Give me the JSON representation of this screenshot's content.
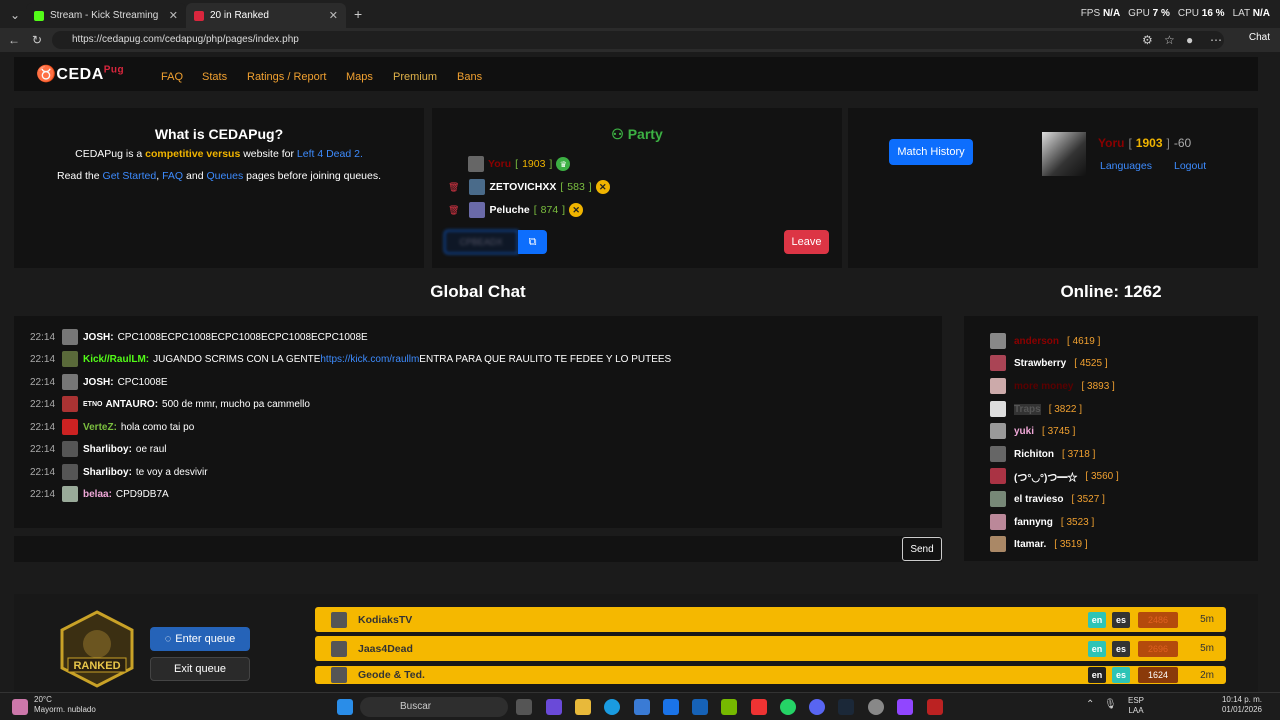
{
  "browser": {
    "tabs": [
      {
        "label": "Stream - Kick Streaming",
        "fav_color": "#53fc18"
      },
      {
        "label": "20 in Ranked",
        "fav_color": "#d9263d"
      }
    ],
    "url": "https://cedapug.com/cedapug/php/pages/index.php",
    "perf": {
      "fps_label": "FPS",
      "fps": "N/A",
      "gpu_label": "GPU",
      "gpu": "7 %",
      "cpu_label": "CPU",
      "cpu": "16 %",
      "lat_label": "LAT",
      "lat": "N/A"
    },
    "chat_label": "Chat"
  },
  "site": {
    "logo_text": "CEDA",
    "logo_sup": "Pug",
    "nav": [
      "FAQ",
      "Stats",
      "Ratings / Report",
      "Maps",
      "Premium",
      "Bans"
    ]
  },
  "about": {
    "title": "What is CEDAPug?",
    "line1_a": "CEDAPug is a ",
    "line1_b": "competitive versus",
    "line1_c": " website for ",
    "line1_d": "Left 4 Dead 2.",
    "line2_a": "Read the ",
    "line2_b": "Get Started",
    "line2_c": ", ",
    "line2_d": "FAQ",
    "line2_e": " and ",
    "line2_f": "Queues",
    "line2_g": " pages before joining queues."
  },
  "party": {
    "title": "Party",
    "members": [
      {
        "name": "Yoru",
        "elo": "1903",
        "badge": "crown",
        "name_color": "#8b0000"
      },
      {
        "name": "ZETOVICHXX",
        "elo": "583",
        "badge": "x",
        "name_color": "#ffffff"
      },
      {
        "name": "Peluche",
        "elo": "874",
        "badge": "x",
        "name_color": "#ffffff"
      }
    ],
    "code_placeholder": "CPBEADX",
    "leave_label": "Leave"
  },
  "profile": {
    "match_history_label": "Match History",
    "name": "Yoru",
    "elo": "1903",
    "delta": "-60",
    "languages_label": "Languages",
    "logout_label": "Logout"
  },
  "chat": {
    "title": "Global Chat",
    "messages": [
      {
        "time": "22:14",
        "nick": "JOSH:",
        "nick_color": "#ffffff",
        "text": "CPC1008ECPC1008ECPC1008ECPC1008ECPC1008E",
        "link": "",
        "text2": "",
        "tag": ""
      },
      {
        "time": "22:14",
        "nick": "Kick//RaulLM:",
        "nick_color": "#53fc18",
        "text": "JUGANDO SCRIMS CON LA GENTE ",
        "link": "https://kick.com/raullm",
        "text2": " ENTRA PARA QUE RAULITO TE FEDEE Y LO PUTEES",
        "tag": ""
      },
      {
        "time": "22:14",
        "nick": "JOSH:",
        "nick_color": "#ffffff",
        "text": "CPC1008E",
        "link": "",
        "text2": "",
        "tag": ""
      },
      {
        "time": "22:14",
        "nick": "ANTAURO:",
        "nick_color": "#ffffff",
        "text": "500 de mmr, mucho pa cammello",
        "link": "",
        "text2": "",
        "tag": "ETNO"
      },
      {
        "time": "22:14",
        "nick": "VerteZ:",
        "nick_color": "#7bbf3f",
        "text": "hola como tai po",
        "link": "",
        "text2": "",
        "tag": ""
      },
      {
        "time": "22:14",
        "nick": "Sharliboy:",
        "nick_color": "#ffffff",
        "text": "oe raul",
        "link": "",
        "text2": "",
        "tag": ""
      },
      {
        "time": "22:14",
        "nick": "Sharliboy:",
        "nick_color": "#ffffff",
        "text": "te voy a desvivir",
        "link": "",
        "text2": "",
        "tag": ""
      },
      {
        "time": "22:14",
        "nick": "belaa:",
        "nick_color": "#f0a8d8",
        "text": "CPD9DB7A",
        "link": "",
        "text2": "",
        "tag": ""
      }
    ],
    "send_label": "Send"
  },
  "online": {
    "title": "Online: 1262",
    "users": [
      {
        "name": "anderson",
        "elo": "4619",
        "color": "#8b0000"
      },
      {
        "name": "Strawberry",
        "elo": "4525",
        "color": "#ffffff"
      },
      {
        "name": "more money",
        "elo": "3893",
        "color": "#5a0000"
      },
      {
        "name": "Traps",
        "elo": "3822",
        "color": "#555555"
      },
      {
        "name": "yuki",
        "elo": "3745",
        "color": "#f0a8d8"
      },
      {
        "name": "Richiton",
        "elo": "3718",
        "color": "#ffffff"
      },
      {
        "name": "(つ°◡°)つ━☆",
        "elo": "3560",
        "color": "#ffffff"
      },
      {
        "name": "el travieso",
        "elo": "3527",
        "color": "#ffffff"
      },
      {
        "name": "fannyng",
        "elo": "3523",
        "color": "#ffffff"
      },
      {
        "name": "Itamar.",
        "elo": "3519",
        "color": "#ffffff"
      }
    ]
  },
  "queue": {
    "rank_label": "RANKED",
    "enter_label": "Enter queue",
    "exit_label": "Exit queue",
    "rows": [
      {
        "name": "KodiaksTV",
        "elo": "2486",
        "time": "5m",
        "elo_faded": true
      },
      {
        "name": "Jaas4Dead",
        "elo": "2696",
        "time": "5m",
        "elo_faded": true
      },
      {
        "name": "Geode & Ted.",
        "elo": "1624",
        "time": "2m",
        "elo_faded": false
      }
    ],
    "lang_en": "en",
    "lang_es": "es"
  },
  "taskbar": {
    "temp": "20°C",
    "weather": "Mayorm. nublado",
    "search_label": "Buscar",
    "lang1": "ESP",
    "lang2": "LAA",
    "time": "10:14 p. m.",
    "date": "01/01/2026"
  }
}
